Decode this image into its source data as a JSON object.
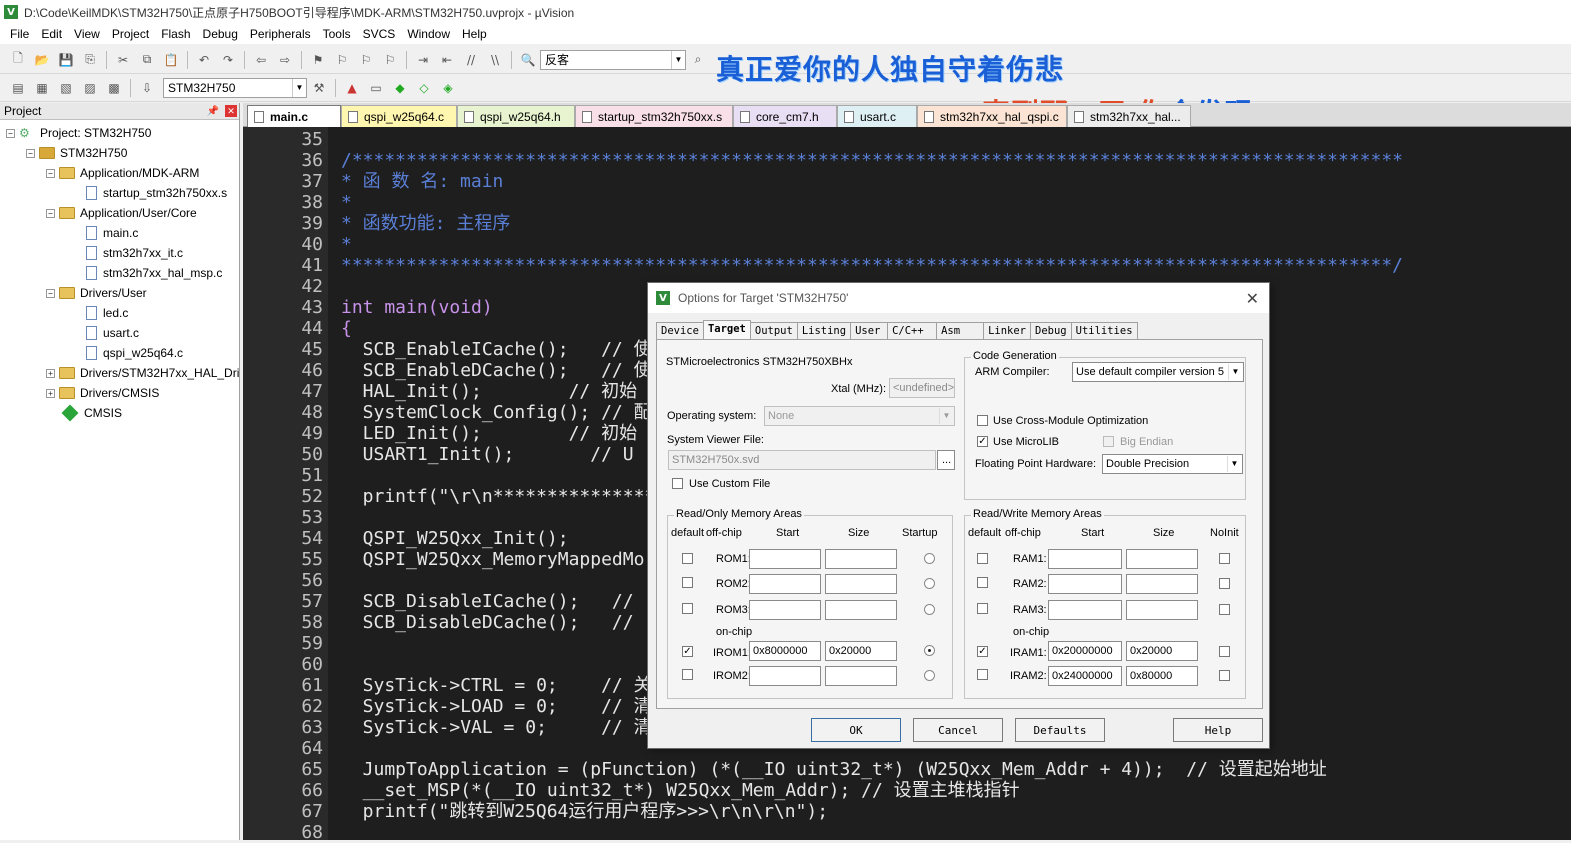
{
  "window": {
    "title": "D:\\Code\\KeilMDK\\STM32H750\\正点原子H750BOOT引导程序\\MDK-ARM\\STM32H750.uvprojx - µVision"
  },
  "menu": [
    "File",
    "Edit",
    "View",
    "Project",
    "Flash",
    "Debug",
    "Peripherals",
    "Tools",
    "SVCS",
    "Window",
    "Help"
  ],
  "toolbar": {
    "search_value": "反客",
    "target_value": "STM32H750"
  },
  "overlay": {
    "line1": "真正爱你的人独自守着伤悲",
    "line2_a": "直到那一天 你",
    "line2_b": "会发现"
  },
  "project": {
    "header": "Project",
    "root": "Project: STM32H750",
    "target": "STM32H750",
    "groups": [
      {
        "name": "Application/MDK-ARM",
        "files": [
          "startup_stm32h750xx.s"
        ]
      },
      {
        "name": "Application/User/Core",
        "files": [
          "main.c",
          "stm32h7xx_it.c",
          "stm32h7xx_hal_msp.c"
        ]
      },
      {
        "name": "Drivers/User",
        "files": [
          "led.c",
          "usart.c",
          "qspi_w25q64.c"
        ]
      },
      {
        "name": "Drivers/STM32H7xx_HAL_Dri"
      },
      {
        "name": "Drivers/CMSIS"
      },
      {
        "name": "CMSIS"
      }
    ]
  },
  "tabs": [
    "main.c",
    "qspi_w25q64.c",
    "qspi_w25q64.h",
    "startup_stm32h750xx.s",
    "core_cm7.h",
    "usart.c",
    "stm32h7xx_hal_qspi.c",
    "stm32h7xx_hal..."
  ],
  "code": [
    {
      "n": "35",
      "t": ""
    },
    {
      "n": "36",
      "t": "/*************************************************************************************************"
    },
    {
      "n": "37",
      "t": "* 函 数 名: main"
    },
    {
      "n": "38",
      "t": "*"
    },
    {
      "n": "39",
      "t": "* 函数功能: 主程序"
    },
    {
      "n": "40",
      "t": "*"
    },
    {
      "n": "41",
      "t": "*************************************************************************************************/"
    },
    {
      "n": "42",
      "t": ""
    },
    {
      "n": "43",
      "t": "int main(void)"
    },
    {
      "n": "44",
      "t": "{"
    },
    {
      "n": "45",
      "t": "  SCB_EnableICache();   // 使"
    },
    {
      "n": "46",
      "t": "  SCB_EnableDCache();   // 使"
    },
    {
      "n": "47",
      "t": "  HAL_Init();        // 初始"
    },
    {
      "n": "48",
      "t": "  SystemClock_Config(); // 配"
    },
    {
      "n": "49",
      "t": "  LED_Init();        // 初始"
    },
    {
      "n": "50",
      "t": "  USART1_Init();       // U"
    },
    {
      "n": "51",
      "t": ""
    },
    {
      "n": "52",
      "t": "  printf(\"\\r\\n****************"
    },
    {
      "n": "53",
      "t": ""
    },
    {
      "n": "54",
      "t": "  QSPI_W25Qxx_Init();"
    },
    {
      "n": "55",
      "t": "  QSPI_W25Qxx_MemoryMappedMo"
    },
    {
      "n": "56",
      "t": ""
    },
    {
      "n": "57",
      "t": "  SCB_DisableICache();   //"
    },
    {
      "n": "58",
      "t": "  SCB_DisableDCache();   //"
    },
    {
      "n": "59",
      "t": ""
    },
    {
      "n": "60",
      "t": ""
    },
    {
      "n": "61",
      "t": "  SysTick->CTRL = 0;    // 关"
    },
    {
      "n": "62",
      "t": "  SysTick->LOAD = 0;    // 清"
    },
    {
      "n": "63",
      "t": "  SysTick->VAL = 0;     // 清"
    },
    {
      "n": "64",
      "t": ""
    },
    {
      "n": "65",
      "t": "  JumpToApplication = (pFunction) (*(__IO uint32_t*) (W25Qxx_Mem_Addr + 4));  // 设置起始地址"
    },
    {
      "n": "66",
      "t": "  __set_MSP(*(__IO uint32_t*) W25Qxx_Mem_Addr); // 设置主堆栈指针"
    },
    {
      "n": "67",
      "t": "  printf(\"跳转到W25Q64运行用户程序>>>\\r\\n\\r\\n\");"
    },
    {
      "n": "68",
      "t": ""
    }
  ],
  "dialog": {
    "title": "Options for Target 'STM32H750'",
    "tabs": [
      "Device",
      "Target",
      "Output",
      "Listing",
      "User",
      "C/C++",
      "Asm",
      "Linker",
      "Debug",
      "Utilities"
    ],
    "device": "STMicroelectronics STM32H750XBHx",
    "xtal_label": "Xtal (MHz):",
    "xtal_value": "<undefined>",
    "os_label": "Operating system:",
    "os_value": "None",
    "svd_label": "System Viewer File:",
    "svd_value": "STM32H750x.svd",
    "browse": "...",
    "custom_file": "Use Custom File",
    "codegen_title": "Code Generation",
    "compiler_label": "ARM Compiler:",
    "compiler_value": "Use default compiler version 5",
    "cross_module": "Use Cross-Module Optimization",
    "microlib": "Use MicroLIB",
    "big_endian": "Big Endian",
    "fp_label": "Floating Point Hardware:",
    "fp_value": "Double Precision",
    "ro_title": "Read/Only Memory Areas",
    "rw_title": "Read/Write Memory Areas",
    "col_default": "default",
    "col_offchip": "off-chip",
    "col_start": "Start",
    "col_size": "Size",
    "col_startup": "Startup",
    "col_noinit": "NoInit",
    "onchip": "on-chip",
    "rom": [
      {
        "name": "ROM1:",
        "start": "",
        "size": ""
      },
      {
        "name": "ROM2:",
        "start": "",
        "size": ""
      },
      {
        "name": "ROM3:",
        "start": "",
        "size": ""
      },
      {
        "name": "IROM1:",
        "start": "0x8000000",
        "size": "0x20000"
      },
      {
        "name": "IROM2:",
        "start": "",
        "size": ""
      }
    ],
    "ram": [
      {
        "name": "RAM1:",
        "start": "",
        "size": ""
      },
      {
        "name": "RAM2:",
        "start": "",
        "size": ""
      },
      {
        "name": "RAM3:",
        "start": "",
        "size": ""
      },
      {
        "name": "IRAM1:",
        "start": "0x20000000",
        "size": "0x20000"
      },
      {
        "name": "IRAM2:",
        "start": "0x24000000",
        "size": "0x80000"
      }
    ],
    "buttons": {
      "ok": "OK",
      "cancel": "Cancel",
      "defaults": "Defaults",
      "help": "Help"
    }
  }
}
